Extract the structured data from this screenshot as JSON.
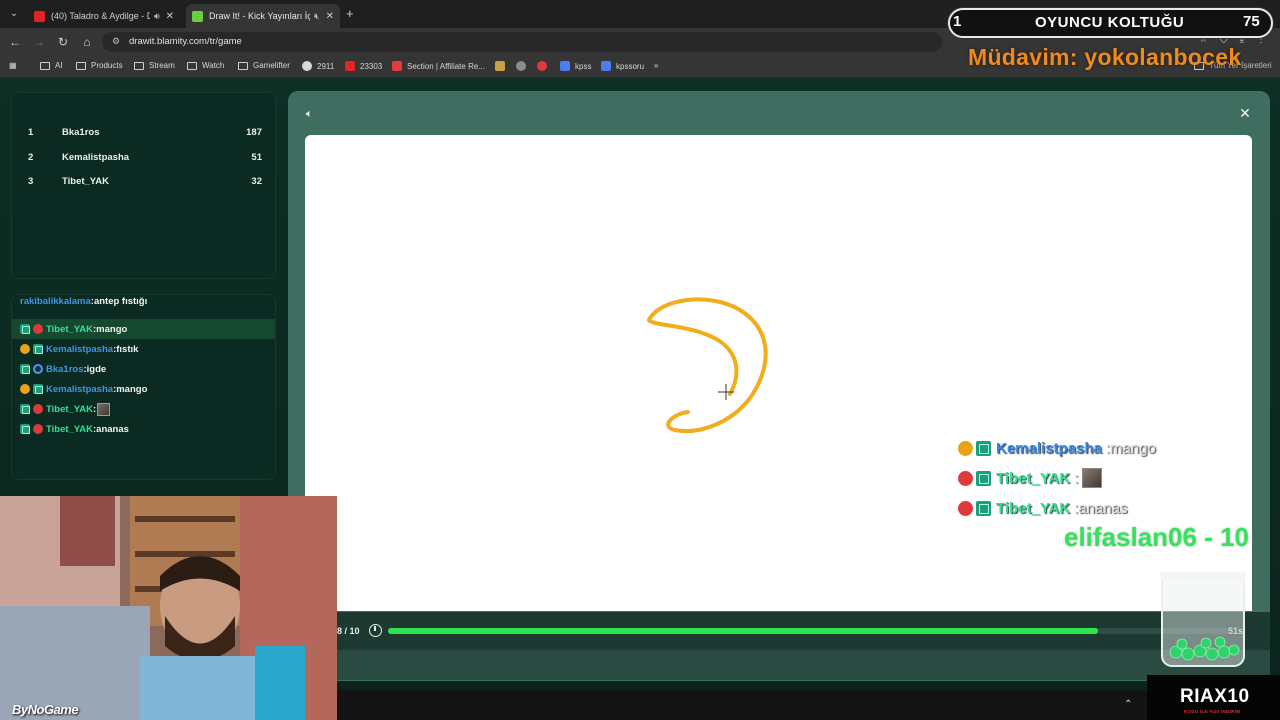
{
  "browser": {
    "tabs": [
      {
        "title": "(40) Taladro & Aydilge - Dü",
        "favicon_color": "#e22323"
      },
      {
        "title": "Draw It! - Kick Yayınları İçin",
        "favicon_color": "#6bcf3c"
      }
    ],
    "url": "drawit.blamity.com/tr/game",
    "bookmarks": [
      {
        "label": "AI",
        "type": "folder"
      },
      {
        "label": "Products",
        "type": "folder"
      },
      {
        "label": "Stream",
        "type": "folder"
      },
      {
        "label": "Watch",
        "type": "folder"
      },
      {
        "label": "Gamelifter",
        "type": "folder"
      },
      {
        "label": "2911",
        "type": "site",
        "color": "#d8d8d8"
      },
      {
        "label": "23303",
        "type": "site",
        "color": "#e22323"
      },
      {
        "label": "Section | Affiliate Re...",
        "type": "site",
        "color": "#e23c3c"
      },
      {
        "label": "kpss",
        "type": "site",
        "color": "#4a7df0"
      },
      {
        "label": "kpssoru",
        "type": "site",
        "color": "#4a7df0"
      }
    ],
    "other_bookmarks": "Tüm Yer İşaretleri"
  },
  "leaderboard": [
    {
      "rank": "1",
      "name": "Bka1ros",
      "score": "187"
    },
    {
      "rank": "2",
      "name": "Kemalistpasha",
      "score": "51"
    },
    {
      "rank": "3",
      "name": "Tibet_YAK",
      "score": "32"
    }
  ],
  "chat": {
    "cut_off": {
      "user": "rakibalikkalama",
      "text": ":antep fıstığı"
    },
    "messages": [
      {
        "user": "Tibet_YAK",
        "text": ":mango",
        "badge": "red",
        "color": "green",
        "highlight": true
      },
      {
        "user": "Kemalistpasha",
        "text": ":fıstık",
        "badge": "gold",
        "color": "blue",
        "highlight": false
      },
      {
        "user": "Bka1ros",
        "text": ":igde",
        "badge": "blue",
        "color": "blue",
        "highlight": false
      },
      {
        "user": "Kemalistpasha",
        "text": ":mango",
        "badge": "gold",
        "color": "blue",
        "highlight": false
      },
      {
        "user": "Tibet_YAK",
        "text": ":",
        "badge": "red",
        "color": "green",
        "highlight": false,
        "thumb": true
      },
      {
        "user": "Tibet_YAK",
        "text": ":ananas",
        "badge": "red",
        "color": "green",
        "highlight": false
      }
    ]
  },
  "game": {
    "round": "8 / 10",
    "time_left": "51s",
    "progress": 0.845,
    "stroke_color": "#f2ac1c"
  },
  "overlay": {
    "rank": "1",
    "title": "OYUNCU KOLTUĞU",
    "count": "75",
    "regular": "Müdavim: yokolanbocek",
    "chat": [
      {
        "user": "Kemalistpasha",
        "sep": " : ",
        "text": "mango",
        "badge": "gold",
        "color": "#3b8ae6"
      },
      {
        "user": "Tibet_YAK",
        "sep": " : ",
        "text": "",
        "badge": "red",
        "color": "#31e196",
        "thumb": true
      },
      {
        "user": "Tibet_YAK",
        "sep": " : ",
        "text": "ananas",
        "badge": "red",
        "color": "#31e196"
      }
    ],
    "ticker": "elifaslan06 - 10",
    "credit": "ByNoGame",
    "promo_title": "RIAX10",
    "promo_sub": "KODU İLE %10 İNDİRİM"
  }
}
